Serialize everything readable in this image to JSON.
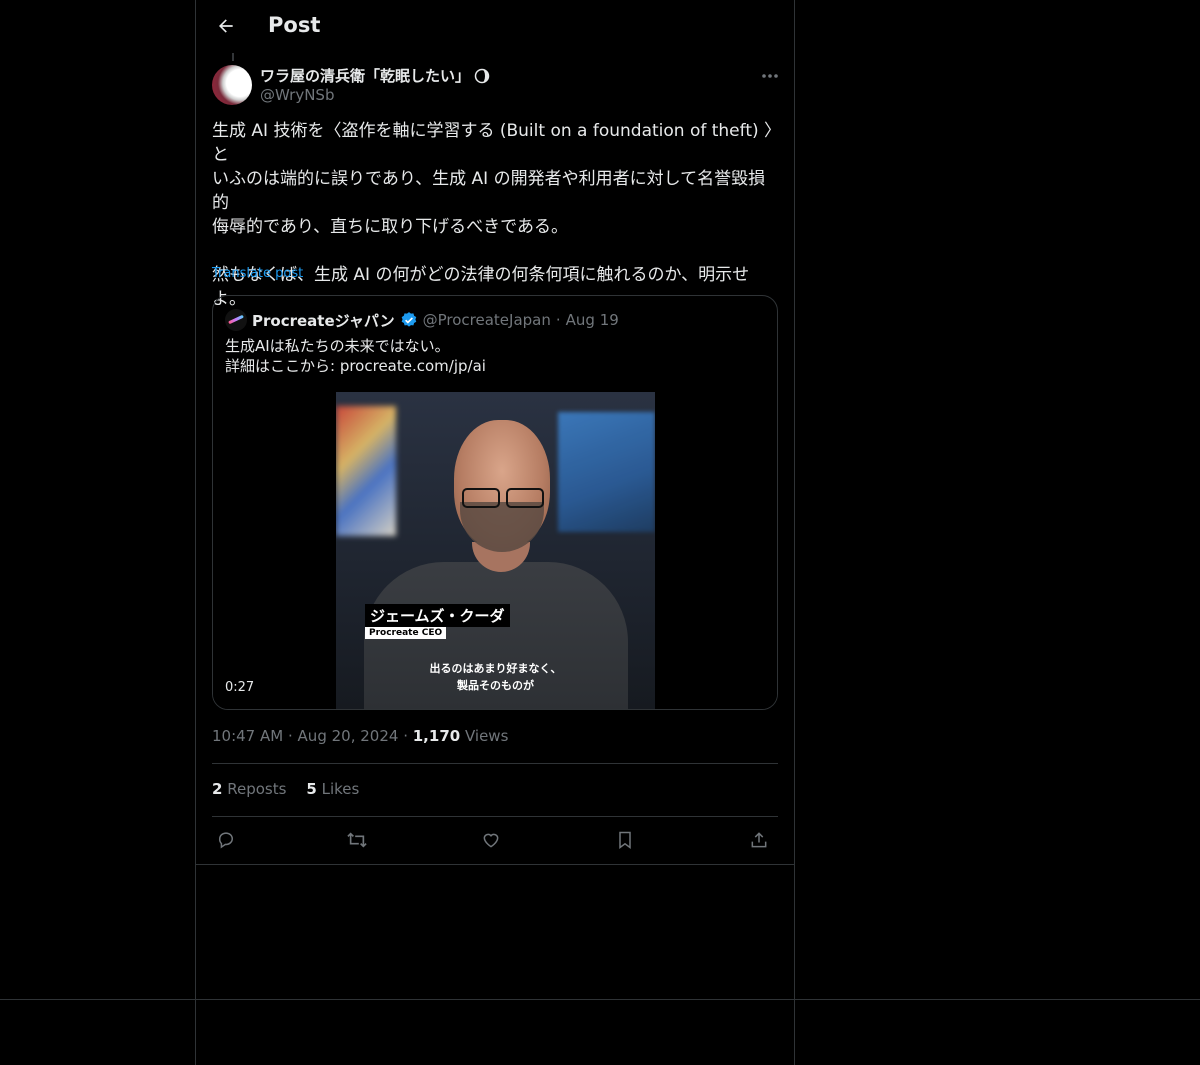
{
  "header": {
    "title": "Post"
  },
  "post": {
    "author_name": "ワラ屋の清兵衛「乾眠したい」",
    "author_handle": "@WryNSb",
    "text": "生成 AI 技術を〈盗作を軸に学習する (Built on a foundation of theft) 〉と\nいふのは端的に誤りであり、生成 AI の開発者や利用者に対して名誉毀損的\n侮辱的であり、直ちに取り下げるべきである。\n\n然もなくば、生成 AI の何がどの法律の何条何項に触れるのか、明示せ\nよ。",
    "translate_label": "Translate post",
    "time": "10:47 AM",
    "date": "Aug 20, 2024",
    "views_count": "1,170",
    "views_label": "Views",
    "reposts_count": "2",
    "reposts_label": "Reposts",
    "likes_count": "5",
    "likes_label": "Likes",
    "separator": "·"
  },
  "quote": {
    "name": "Procreateジャパン",
    "handle": "@ProcreateJapan",
    "date": "Aug 19",
    "separator": "·",
    "text": "生成AIは私たちの未来ではない。\n詳細はここから: procreate.com/jp/ai",
    "video": {
      "caption_name": "ジェームズ・クーダ",
      "caption_role": "Procreate CEO",
      "subtitle": "出るのはあまり好まなく、\n製品そのものが",
      "duration": "0:27"
    }
  },
  "colors": {
    "background": "#000000",
    "text": "#e7e9ea",
    "muted": "#71767b",
    "accent": "#1d9bf0",
    "border": "#2f3336"
  },
  "icons": {
    "back": "arrow-left-icon",
    "more": "more-horizontal-icon",
    "verified": "verified-badge-icon",
    "reply": "reply-icon",
    "repost": "repost-icon",
    "like": "heart-icon",
    "bookmark": "bookmark-icon",
    "share": "share-icon"
  }
}
